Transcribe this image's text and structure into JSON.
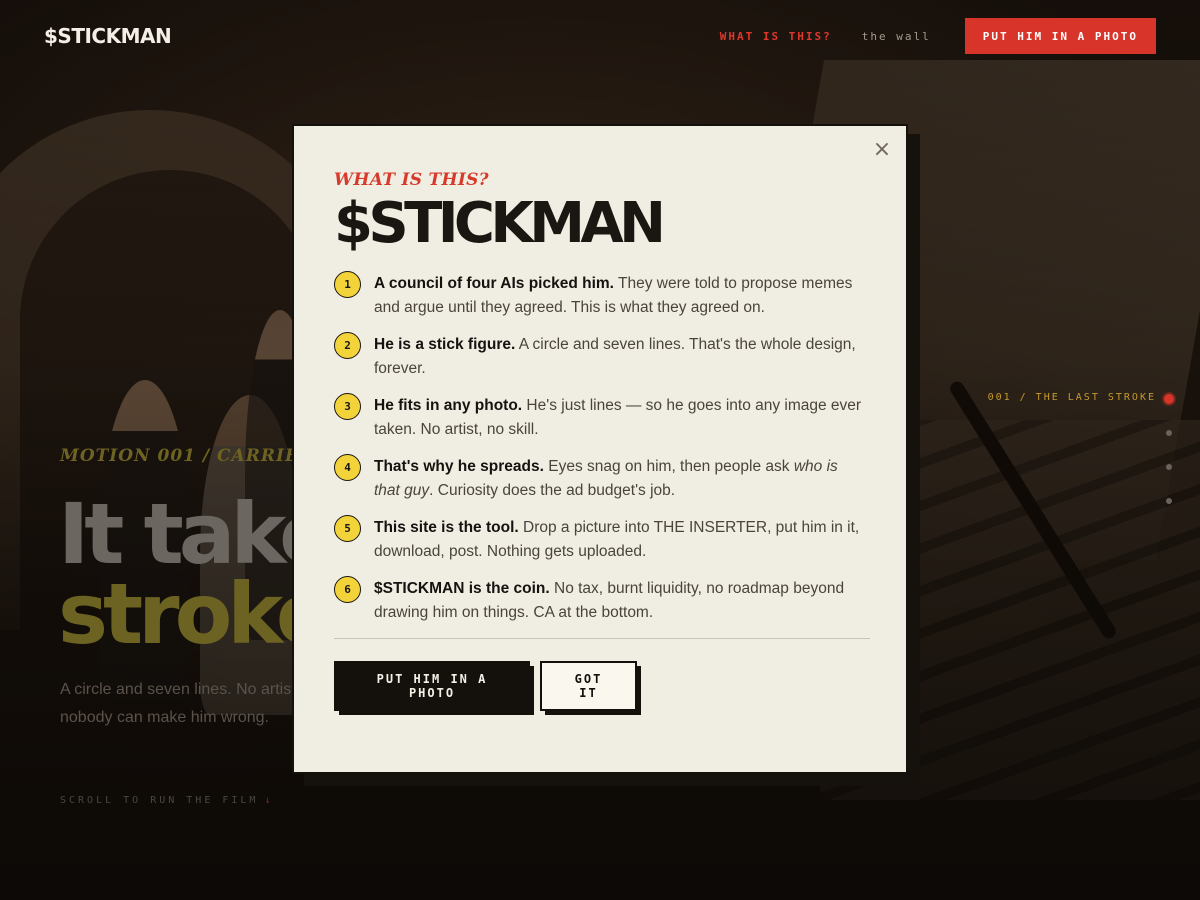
{
  "nav": {
    "logo": "$STICKMAN",
    "links": [
      {
        "label": "WHAT IS THIS?",
        "active": true
      },
      {
        "label": "the wall",
        "active": false
      }
    ],
    "cta_label": "PUT HIM IN A PHOTO"
  },
  "hero": {
    "kicker": "MOTION 001 / CARRIED",
    "line1": "It takes",
    "line2": "strokes.",
    "subtitle": "A circle and seven lines. No artist, no skill. Anybody can make him and nobody can make him wrong.",
    "scroll_hint": "SCROLL TO RUN THE FILM",
    "scroll_arrow": "↓"
  },
  "progress": {
    "label": "001 / THE LAST STROKE",
    "dots": 4,
    "active_index": 0
  },
  "modal": {
    "kicker": "WHAT IS THIS?",
    "title": "$STICKMAN",
    "close_glyph": "×",
    "items": [
      {
        "num": "1",
        "bold": "A council of four AIs picked him.",
        "text": " They were told to propose memes and argue until they agreed. This is what they agreed on."
      },
      {
        "num": "2",
        "bold": "He is a stick figure.",
        "text": " A circle and seven lines. That's the whole design, forever."
      },
      {
        "num": "3",
        "bold": "He fits in any photo.",
        "text": " He's just lines — so he goes into any image ever taken. No artist, no skill."
      },
      {
        "num": "4",
        "bold": "That's why he spreads.",
        "text": " Eyes snag on him, then people ask ",
        "italic": "who is that guy",
        "after": ". Curiosity does the ad budget's job."
      },
      {
        "num": "5",
        "bold": "This site is the tool.",
        "text": " Drop a picture into THE INSERTER, put him in it, download, post. Nothing gets uploaded."
      },
      {
        "num": "6",
        "bold": "$STICKMAN is the coin.",
        "text": " No tax, burnt liquidity, no roadmap beyond drawing him on things. CA at the bottom."
      }
    ],
    "primary_button": "PUT HIM IN A PHOTO",
    "secondary_button": "GOT IT"
  },
  "colors": {
    "accent_red": "#d9342a",
    "badge_yellow": "#f3d33a",
    "modal_bg": "#f0ede2",
    "ink": "#14110d"
  }
}
